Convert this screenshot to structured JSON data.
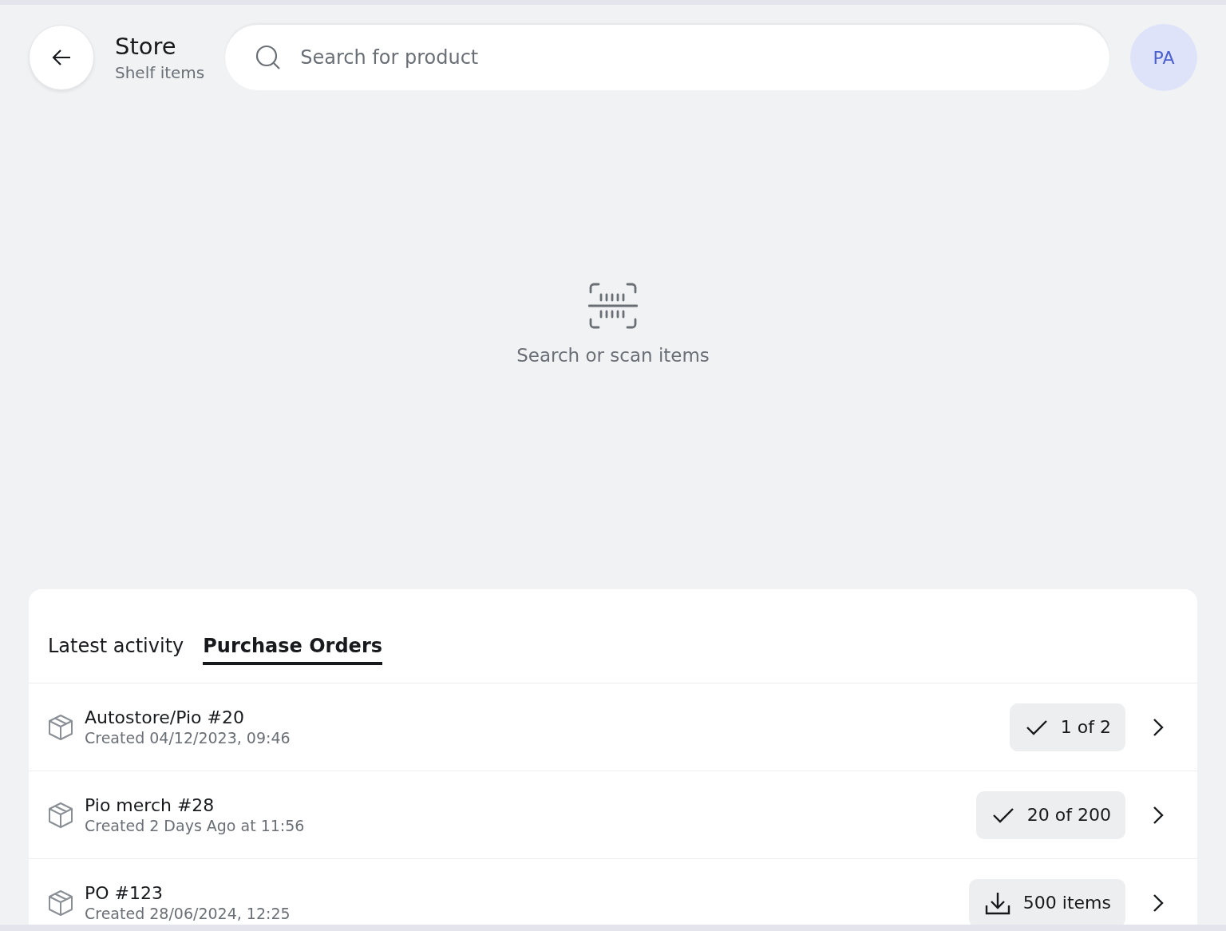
{
  "header": {
    "title": "Store",
    "subtitle": "Shelf items",
    "search": {
      "placeholder": "Search for product"
    },
    "avatar": "PA"
  },
  "empty_state": {
    "message": "Search or scan items"
  },
  "tabs": [
    {
      "label": "Latest activity",
      "selected": false
    },
    {
      "label": "Purchase Orders",
      "selected": true
    }
  ],
  "orders": [
    {
      "name": "Autostore/Pio #20",
      "created": "Created 04/12/2023, 09:46",
      "action": {
        "kind": "progress",
        "label": "1 of 2"
      }
    },
    {
      "name": "Pio merch #28",
      "created": "Created 2 Days Ago at 11:56",
      "action": {
        "kind": "progress",
        "label": "20 of 200"
      }
    },
    {
      "name": "PO #123",
      "created": "Created 28/06/2024, 12:25",
      "action": {
        "kind": "download",
        "label": "500 items"
      }
    }
  ]
}
